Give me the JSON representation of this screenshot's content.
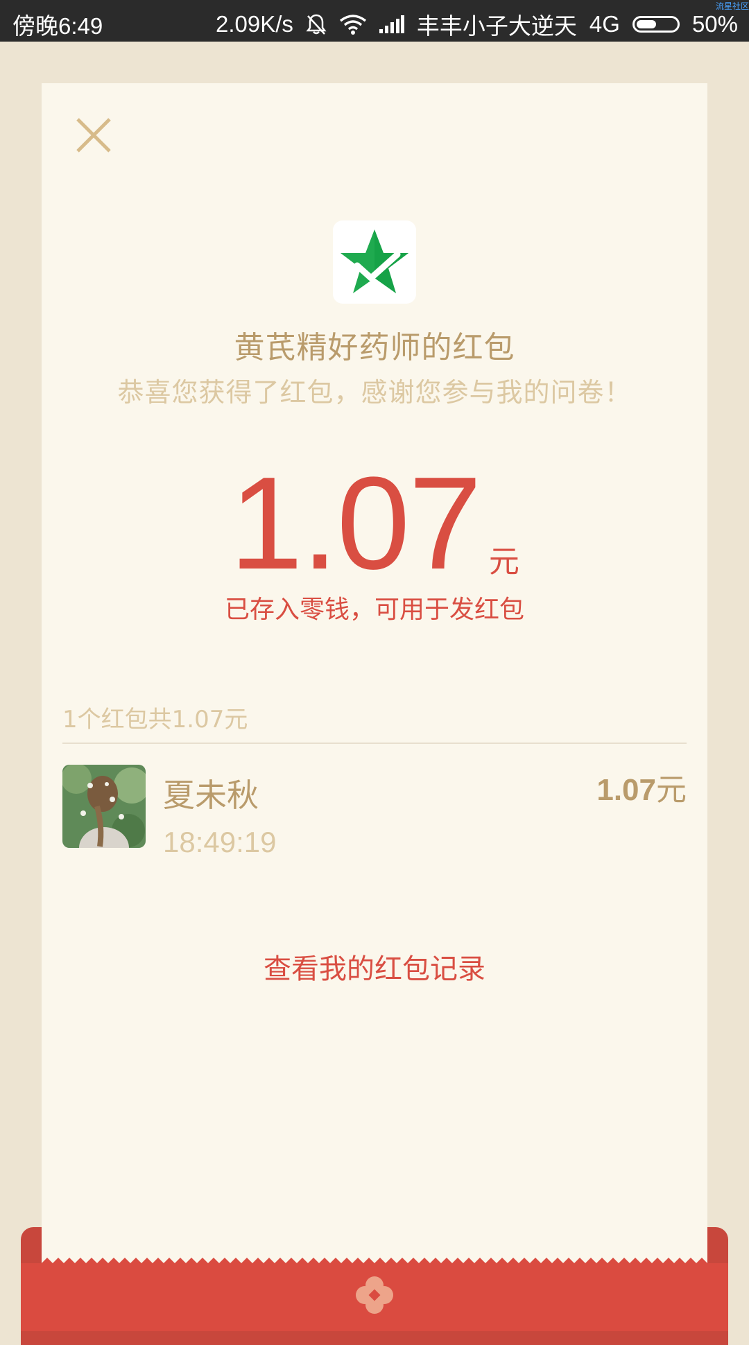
{
  "status_bar": {
    "time": "傍晚6:49",
    "network_speed": "2.09K/s",
    "carrier": "丰丰小子大逆天",
    "network_type": "4G",
    "battery": "50%",
    "battery_level": 0.5,
    "watermark": "流星社区"
  },
  "packet": {
    "sender_name": "黄芪精好药师的红包",
    "greeting": "恭喜您获得了红包，感谢您参与我的问卷！",
    "amount": "1.07",
    "currency": "元",
    "saved_note": "已存入零钱，可用于发红包"
  },
  "records": {
    "summary": "1个红包共1.07元",
    "items": [
      {
        "name": "夏未秋",
        "time": "18:49:19",
        "amount": "1.07",
        "currency": "元"
      }
    ]
  },
  "history_link": "查看我的红包记录",
  "colors": {
    "accent_red": "#d94e42",
    "gold_text": "#b99b6b",
    "light_gold_text": "#dcc8a2",
    "card_bg": "#fbf7ec",
    "page_bg": "#ede4d2"
  },
  "icons": {
    "close": "close-icon",
    "logo": "star-check-logo-icon",
    "emblem": "flower-emblem-icon"
  }
}
